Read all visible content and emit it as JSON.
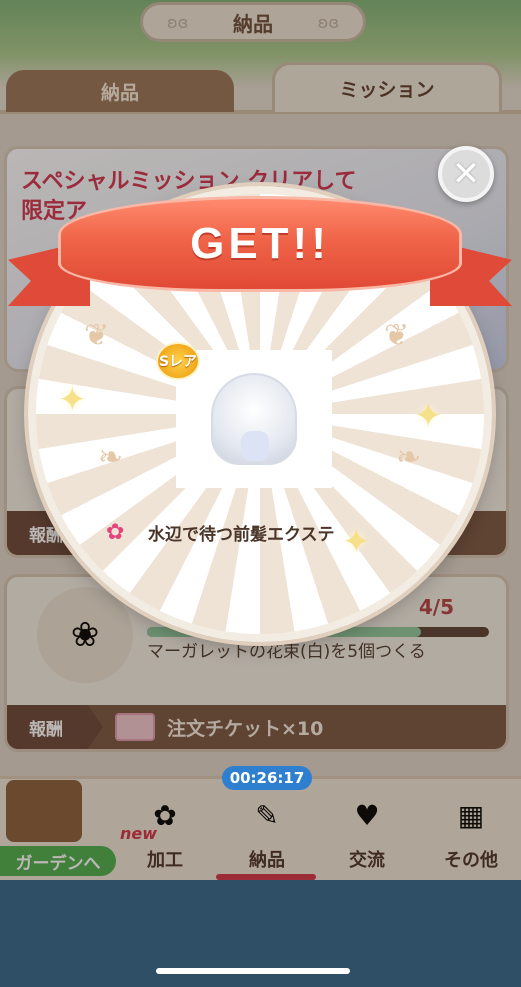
{
  "header": {
    "title": "納品"
  },
  "tabs": [
    {
      "label": "納品",
      "active": false
    },
    {
      "label": "ミッション",
      "active": true
    }
  ],
  "banner": {
    "line1": "スペシャルミッション クリアして",
    "line2": "限定ア"
  },
  "cards": {
    "first": {
      "reward_label": "報酬"
    },
    "second": {
      "progress": "4/5",
      "progress_fraction": 0.8,
      "description": "マーガレットの花束(白)を5個つくる",
      "reward_label": "報酬",
      "reward_text": "注文チケット×10"
    }
  },
  "popup": {
    "banner_text": "GET!!",
    "rarity": "Sレア",
    "item_name": "水辺で待つ前髪エクステ",
    "close_symbol": "✕"
  },
  "nav": {
    "timer": "00:26:17",
    "garden_label": "ガーデンへ",
    "new_badge": "new",
    "items": [
      {
        "label": "加工"
      },
      {
        "label": "納品"
      },
      {
        "label": "交流"
      },
      {
        "label": "その他"
      }
    ]
  },
  "colors": {
    "accent_red": "#e04a38",
    "reward_bar": "#7a5440",
    "timer_blue": "#2f7fd1",
    "garden_green": "#4cae4c"
  }
}
